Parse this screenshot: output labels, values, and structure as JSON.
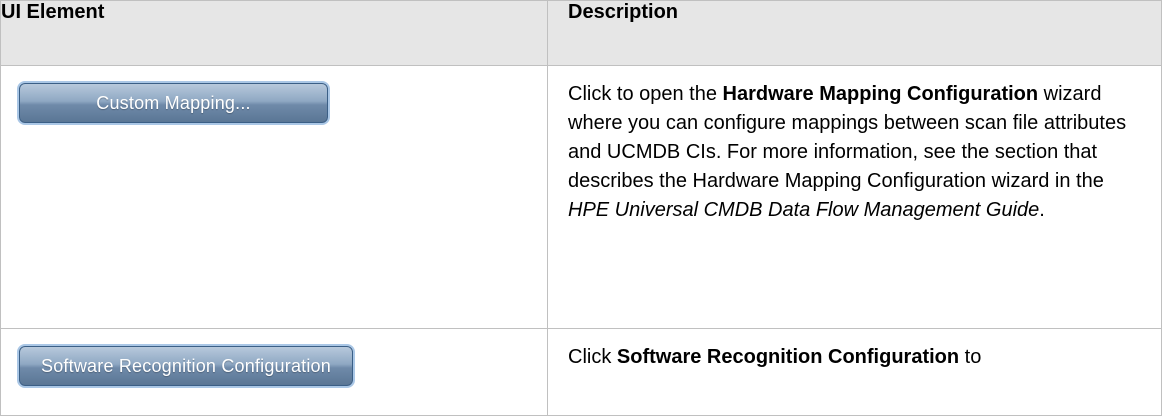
{
  "header": {
    "col1": "UI Element",
    "col2": "Description"
  },
  "rows": [
    {
      "button_label": "Custom Mapping...",
      "desc": {
        "t1": "Click to open the ",
        "b1": "Hardware Mapping Configuration",
        "t2": " wizard where you can configure mappings between scan file attributes and UCMDB CIs. For more information, see the section that describes the Hardware Mapping Configuration wizard in the ",
        "i1": "HPE Universal CMDB Data Flow Management Guide",
        "t3": "."
      }
    },
    {
      "button_label": "Software Recognition Configuration",
      "desc": {
        "t1": "Click ",
        "b1": "Software Recognition Configuration",
        "t2": " to"
      }
    }
  ]
}
